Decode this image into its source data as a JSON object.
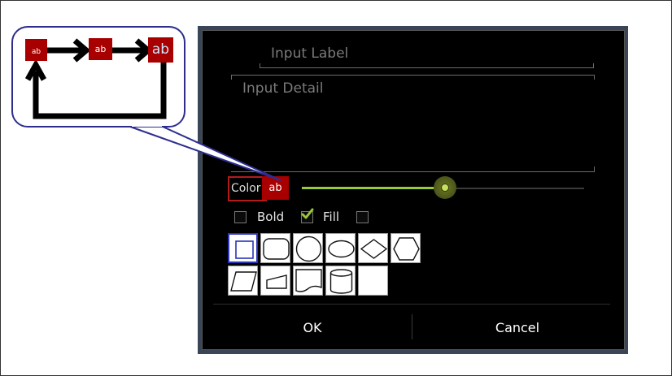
{
  "dialog": {
    "label_placeholder": "Input Label",
    "detail_placeholder": "Input Detail",
    "color_label": "Color",
    "color_swatch_text": "ab",
    "color_level": 0.5,
    "bold_label": "Bold",
    "bold_checked": false,
    "fill_label": "Fill",
    "fill_checked": true,
    "extra_checked": false,
    "ok_label": "OK",
    "cancel_label": "Cancel",
    "shapes": [
      "rectangle",
      "rounded-rectangle",
      "circle",
      "ellipse",
      "diamond",
      "hexagon",
      "parallelogram",
      "manual-input",
      "document",
      "cylinder",
      "empty"
    ],
    "selected_shape": "rectangle"
  },
  "callout": {
    "nodes": [
      {
        "text": "ab"
      },
      {
        "text": "ab"
      },
      {
        "text": "ab"
      }
    ]
  },
  "colors": {
    "accent_red": "#a80000",
    "slider_green": "#9ac73a",
    "selection_blue": "#2a35b8",
    "callout_border": "#2d2d8f"
  }
}
